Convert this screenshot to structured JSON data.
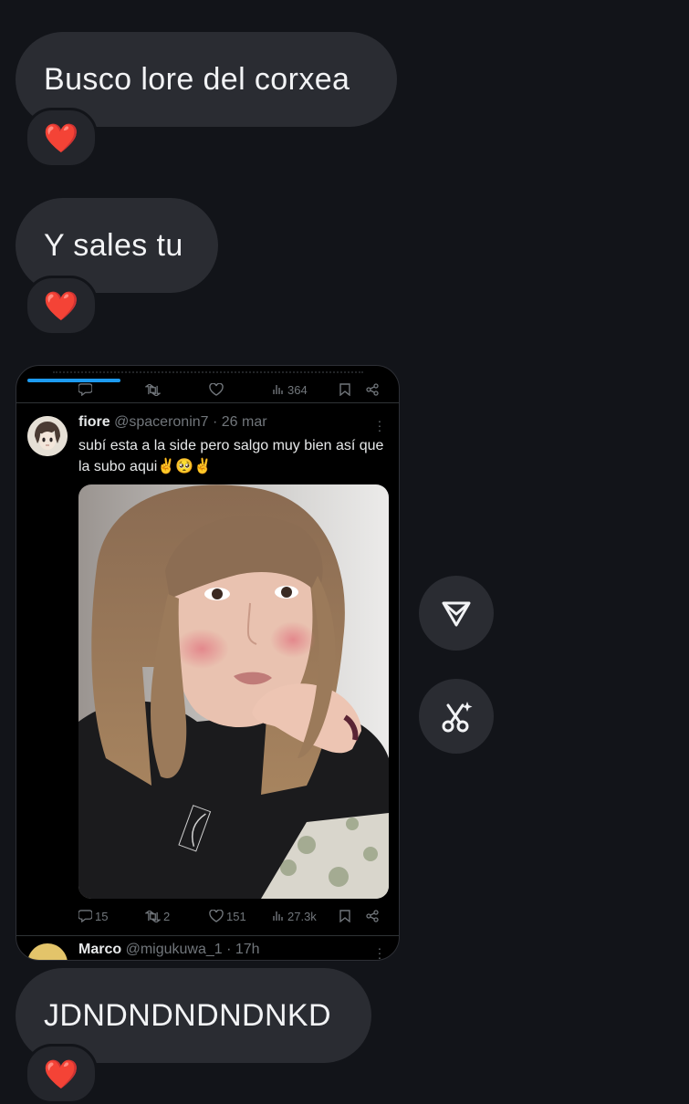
{
  "messages": [
    {
      "text": "Busco lore del corxea",
      "reaction": "❤️"
    },
    {
      "text": "Y sales tu",
      "reaction": "❤️"
    },
    {
      "text": "JDNDNDNDNDNKD",
      "reaction": "❤️"
    }
  ],
  "shared_post": {
    "top_row": {
      "views": "364"
    },
    "tweet": {
      "display_name": "fiore",
      "handle": "@spaceronin7",
      "date": "· 26 mar",
      "text": "subí esta a la side pero salgo muy bien así que la subo aqui✌️🥺✌️",
      "replies": "15",
      "retweets": "2",
      "likes": "151",
      "views": "27.3k"
    },
    "next_tweet": {
      "display_name": "Marco",
      "handle": "@migukuwa_1",
      "date": "· 17h"
    }
  },
  "side_actions": {
    "share": "send-icon",
    "remix": "scissors-sparkle-icon"
  },
  "colors": {
    "background": "#121419",
    "bubble": "#2a2c32",
    "heart": "#e0262e",
    "tweet_accent": "#1d9bf0"
  }
}
